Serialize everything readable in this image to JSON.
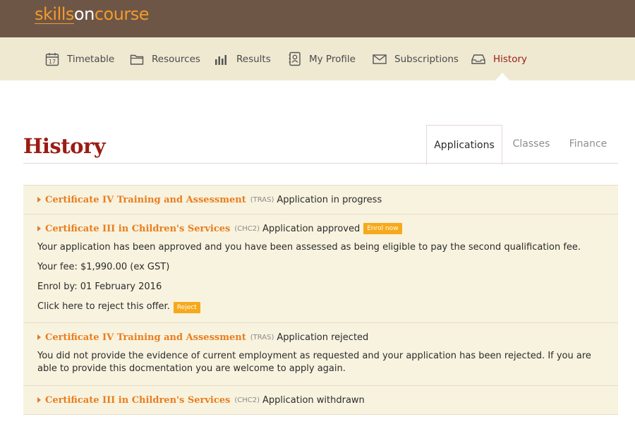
{
  "brand": {
    "part1": "skills",
    "part2": "on",
    "part3": "course"
  },
  "nav": {
    "items": [
      {
        "label": "Timetable",
        "icon": "calendar-icon"
      },
      {
        "label": "Resources",
        "icon": "folder-icon"
      },
      {
        "label": "Results",
        "icon": "bar-chart-icon"
      },
      {
        "label": "My Profile",
        "icon": "profile-icon"
      },
      {
        "label": "Subscriptions",
        "icon": "envelope-icon"
      },
      {
        "label": "History",
        "icon": "inbox-tray-icon",
        "active": true
      }
    ]
  },
  "page": {
    "title": "History"
  },
  "tabs": [
    {
      "label": "Applications",
      "active": true
    },
    {
      "label": "Classes"
    },
    {
      "label": "Finance"
    }
  ],
  "applications": [
    {
      "course": "Certificate IV Training and Assessment",
      "code": "(TRAS)",
      "status": "Application in progress"
    },
    {
      "course": "Certificate III in Children's Services",
      "code": "(CHC2)",
      "status": "Application approved",
      "badge": "Enrol now",
      "details": [
        "Your application has been approved and you have been assessed as being eligible to pay the second qualification fee.",
        "Your fee: $1,990.00 (ex GST)",
        "Enrol by: 01 February 2016"
      ],
      "reject_text": "Click here to reject this offer.",
      "reject_label": "Reject"
    },
    {
      "course": "Certificate IV Training and Assessment",
      "code": "(TRAS)",
      "status": "Application rejected",
      "details": [
        "You did not provide the evidence of current employment as requested and your application has been rejected. If you are able to provide this docmentation you are welcome to apply again."
      ]
    },
    {
      "course": "Certificate III in Children's Services",
      "code": "(CHC2)",
      "status": "Application withdrawn"
    }
  ],
  "colors": {
    "topbar": "#6e5647",
    "navbar": "#efe9d2",
    "accent": "#ea7d1e",
    "title": "#9b1c14",
    "badge": "#f6a91a",
    "panel": "#f8f3df"
  }
}
